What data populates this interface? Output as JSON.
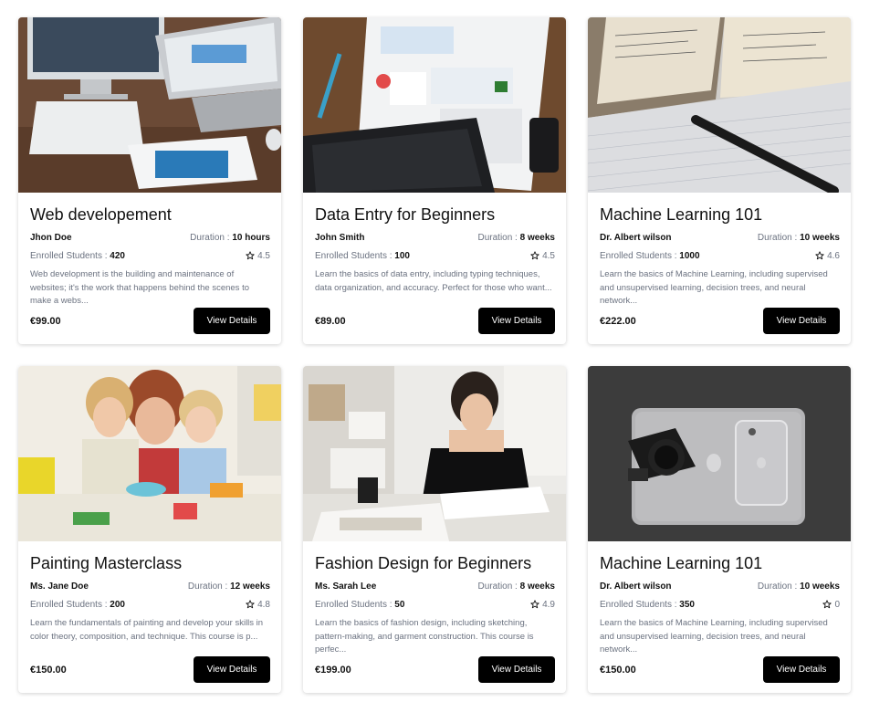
{
  "labels": {
    "duration": "Duration :",
    "enrolled": "Enrolled Students :",
    "cta": "View Details"
  },
  "courses": [
    {
      "title": "Web developement",
      "author": "Jhon Doe",
      "duration": "10 hours",
      "enrolled": "420",
      "rating": "4.5",
      "description": "Web development is the building and maintenance of websites; it's the work that happens behind the scenes to make a webs...",
      "price": "€99.00",
      "image": "desk-computers-photo"
    },
    {
      "title": "Data Entry for Beginners",
      "author": "John Smith",
      "duration": "8 weeks",
      "enrolled": "100",
      "rating": "4.5",
      "description": "Learn the basics of data entry, including typing techniques, data organization, and accuracy. Perfect for those who want...",
      "price": "€89.00",
      "image": "keyboard-report-photo"
    },
    {
      "title": "Machine Learning 101",
      "author": "Dr. Albert wilson",
      "duration": "10 weeks",
      "enrolled": "1000",
      "rating": "4.6",
      "description": "Learn the basics of Machine Learning, including supervised and unsupervised learning, decision trees, and neural network...",
      "price": "€222.00",
      "image": "notebook-pen-photo"
    },
    {
      "title": "Painting Masterclass",
      "author": "Ms. Jane Doe",
      "duration": "12 weeks",
      "enrolled": "200",
      "rating": "4.8",
      "description": "Learn the fundamentals of painting and develop your skills in color theory, composition, and technique. This course is p...",
      "price": "€150.00",
      "image": "kids-painting-photo"
    },
    {
      "title": "Fashion Design for Beginners",
      "author": "Ms. Sarah Lee",
      "duration": "8 weeks",
      "enrolled": "50",
      "rating": "4.9",
      "description": "Learn the basics of fashion design, including sketching, pattern-making, and garment construction. This course is perfec...",
      "price": "€199.00",
      "image": "designer-sketching-photo"
    },
    {
      "title": "Machine Learning 101",
      "author": "Dr. Albert wilson",
      "duration": "10 weeks",
      "enrolled": "350",
      "rating": "0",
      "description": "Learn the basics of Machine Learning, including supervised and unsupervised learning, decision trees, and neural network...",
      "price": "€150.00",
      "image": "camera-laptop-photo"
    }
  ]
}
